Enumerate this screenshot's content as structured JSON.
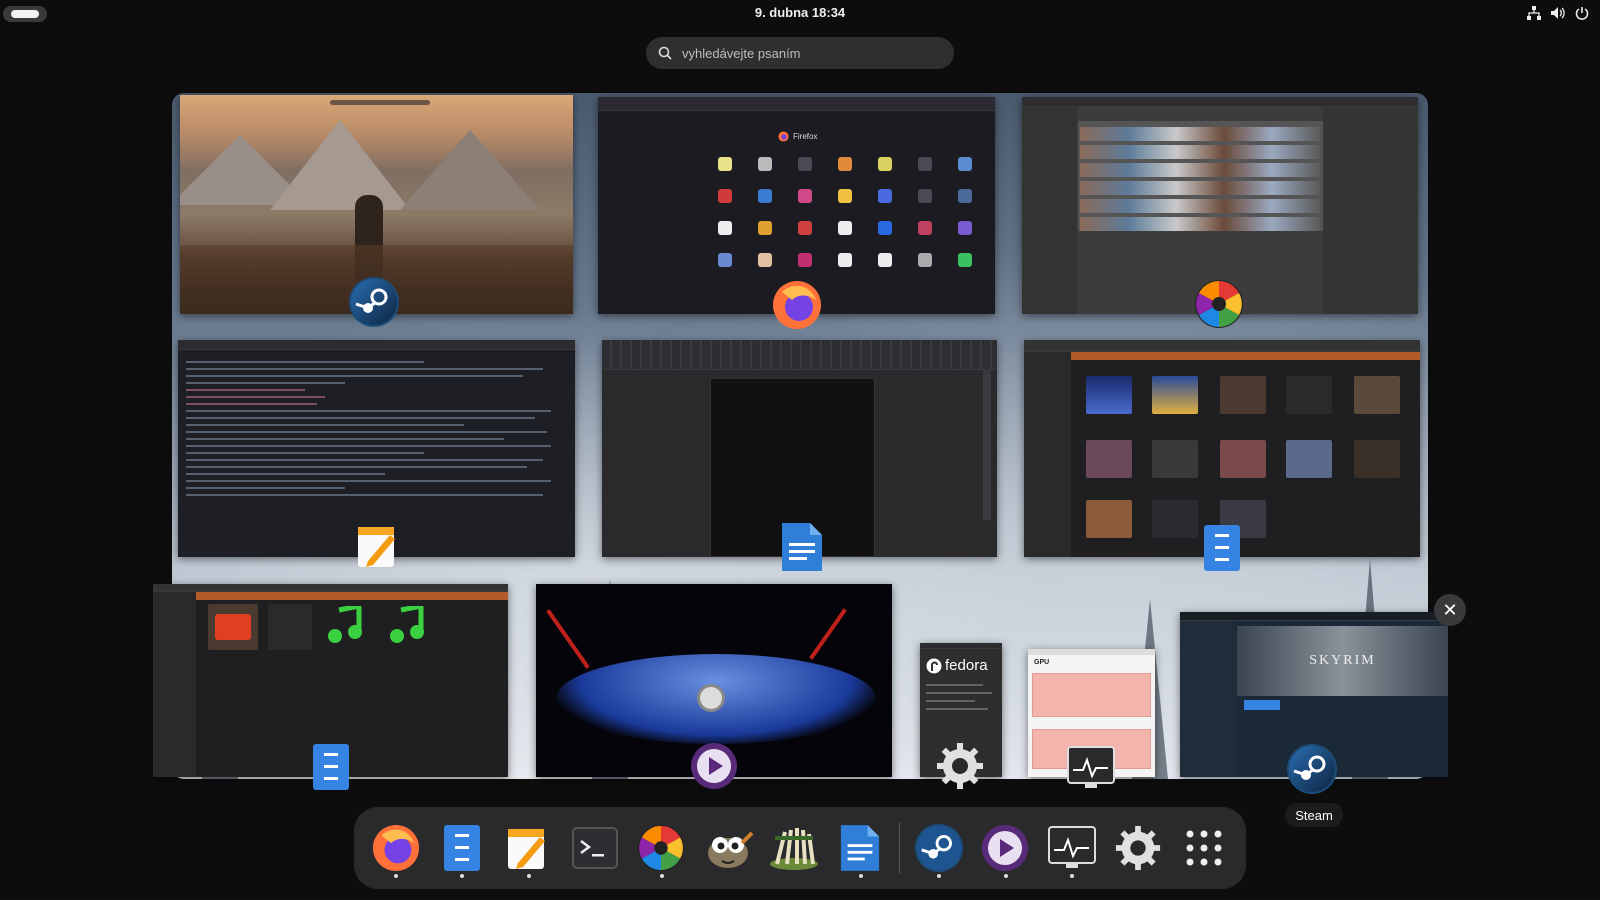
{
  "topbar": {
    "clock": "9. dubna  18:34",
    "tray_icons": [
      "network-icon",
      "volume-icon",
      "power-icon"
    ]
  },
  "search": {
    "placeholder": "vyhledávejte psaním"
  },
  "windows": [
    {
      "name": "skyrim-game-window",
      "app": "Steam",
      "icon": "steam-icon"
    },
    {
      "name": "firefox-window",
      "app": "Firefox",
      "label": "Firefox",
      "icon": "firefox-icon"
    },
    {
      "name": "darktable-window",
      "app": "darktable",
      "icon": "darktable-icon"
    },
    {
      "name": "text-editor-window",
      "app": "Text Editor",
      "icon": "text-editor-icon"
    },
    {
      "name": "writer-window",
      "app": "LibreOffice Writer",
      "icon": "writer-icon"
    },
    {
      "name": "files-videos-window",
      "app": "Files",
      "icon": "files-icon"
    },
    {
      "name": "files-music-window",
      "app": "Files",
      "icon": "files-icon"
    },
    {
      "name": "video-player-window",
      "app": "Celluloid",
      "icon": "video-player-icon"
    },
    {
      "name": "fedora-about-window",
      "app": "Settings",
      "label": "fedora",
      "icon": "settings-icon"
    },
    {
      "name": "system-monitor-window",
      "app": "System Monitor",
      "label": "GPU",
      "icon": "system-monitor-icon"
    },
    {
      "name": "steam-client-window",
      "app": "Steam",
      "label": "SKYRIM",
      "icon": "steam-icon"
    }
  ],
  "tooltip": {
    "text": "Steam"
  },
  "close_symbol": "✕",
  "dash": {
    "items": [
      {
        "name": "dash-firefox",
        "icon": "firefox-icon",
        "running": true
      },
      {
        "name": "dash-files",
        "icon": "files-icon",
        "running": true
      },
      {
        "name": "dash-text-editor",
        "icon": "text-editor-icon",
        "running": true
      },
      {
        "name": "dash-terminal",
        "icon": "terminal-icon",
        "running": false
      },
      {
        "name": "dash-darktable",
        "icon": "darktable-icon",
        "running": true
      },
      {
        "name": "dash-gimp",
        "icon": "gimp-icon",
        "running": false
      },
      {
        "name": "dash-game",
        "icon": "game-icon",
        "running": false
      },
      {
        "name": "dash-writer",
        "icon": "writer-icon",
        "running": true
      },
      {
        "name": "dash-steam",
        "icon": "steam-icon",
        "running": true
      },
      {
        "name": "dash-video-player",
        "icon": "video-player-icon",
        "running": true
      },
      {
        "name": "dash-system-monitor",
        "icon": "system-monitor-icon",
        "running": true
      },
      {
        "name": "dash-settings",
        "icon": "settings-icon",
        "running": false
      },
      {
        "name": "dash-app-grid",
        "icon": "app-grid-icon",
        "running": false
      }
    ]
  },
  "colors": {
    "panel": "#0d0d0d",
    "dash": "#2a2a2c",
    "accent_blue": "#3584e4"
  }
}
